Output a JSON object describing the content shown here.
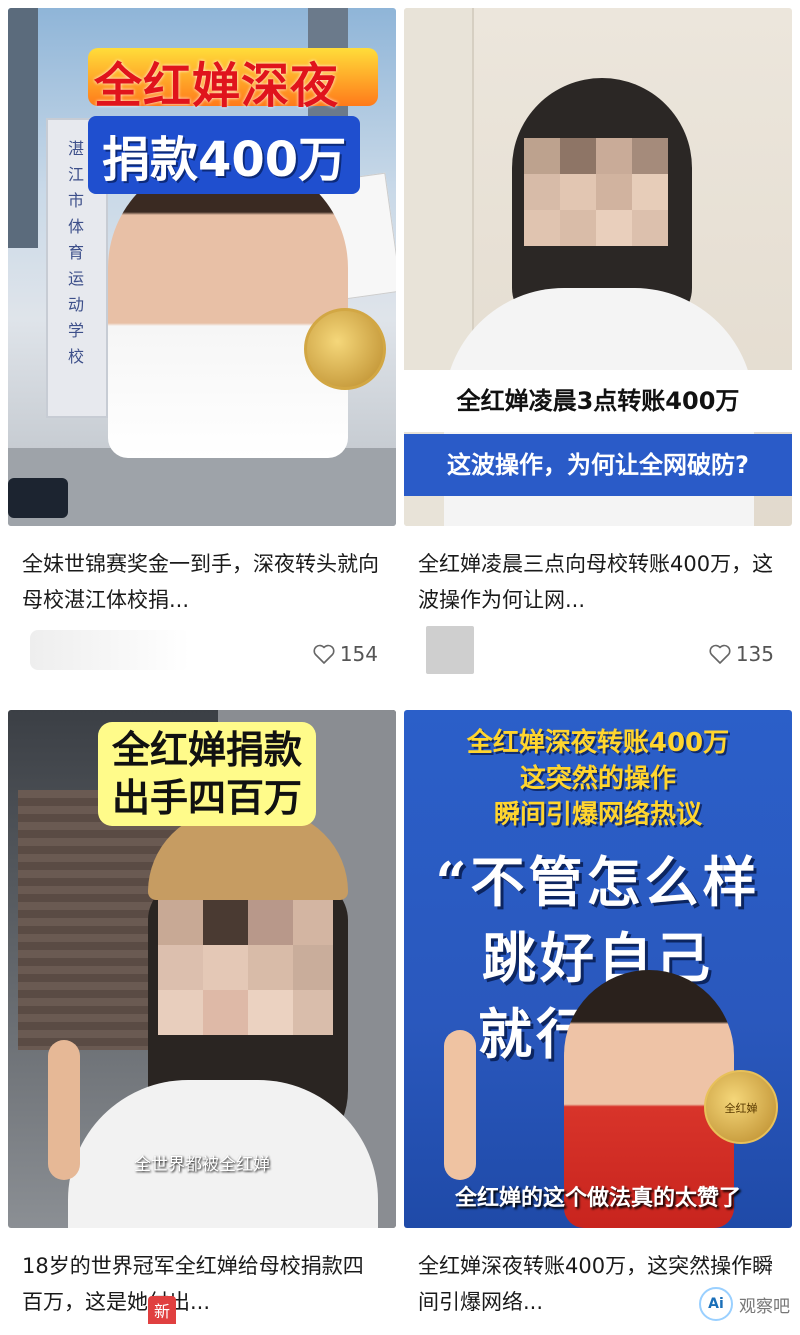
{
  "cards": [
    {
      "thumb": {
        "headline_line1": "全红婵深夜",
        "headline_line2": "捐款400万",
        "gate_text": "湛江市体育运动学校"
      },
      "caption": "全妹世锦赛奖金一到手，深夜转头就向母校湛江体校捐...",
      "likes": "154"
    },
    {
      "thumb": {
        "caption_line1": "全红婵凌晨3点转账400万",
        "caption_line2": "这波操作，为何让全网破防?"
      },
      "caption": "全红婵凌晨三点向母校转账400万，这波操作为何让网...",
      "likes": "135"
    },
    {
      "thumb": {
        "headline_line1": "全红婵捐款",
        "headline_line2": "出手四百万",
        "subtitle": "全世界都被全红婵"
      },
      "caption": "18岁的世界冠军全红婵给母校捐款四百万，这是她付出..."
    },
    {
      "thumb": {
        "headline_line1": "全红婵深夜转账400万",
        "headline_line2": "这突然的操作",
        "headline_line3": "瞬间引爆网络热议",
        "quote_line1": "“不管怎么样",
        "quote_line2": "跳好自己",
        "quote_line3": "就行了。”",
        "seal_text": "全红婵",
        "bottom_caption": "全红婵的这个做法真的太赞了"
      },
      "caption": "全红婵深夜转账400万，这突然操作瞬间引爆网络..."
    }
  ],
  "bottom_tag": "新",
  "watermark": {
    "logo": "Ai",
    "text": "观察吧"
  },
  "icons": {
    "like": "heart-outline-icon"
  }
}
